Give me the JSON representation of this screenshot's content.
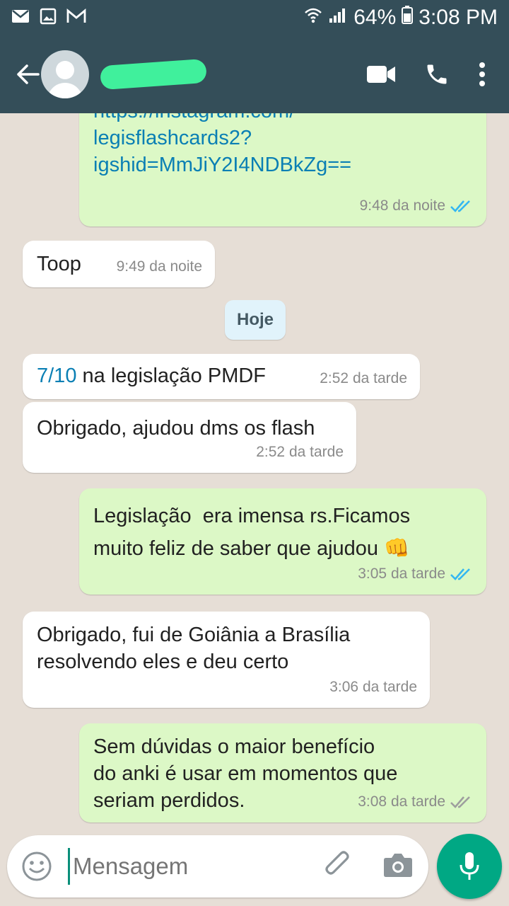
{
  "status_bar": {
    "battery": "64%",
    "time": "3:08 PM"
  },
  "app_bar": {
    "contact_name": ""
  },
  "messages": [
    {
      "dir": "out",
      "lines": [
        "https://instagram.com/",
        "legisflashcards2?",
        "igshid=MmJiY2I4NDBkZg=="
      ],
      "time": "9:48 da noite",
      "ticks": "read"
    },
    {
      "dir": "in",
      "text": "Toop",
      "time": "9:49 da noite"
    },
    {
      "dir": "in",
      "prefix_link": "7/10",
      "text": " na legislação PMDF",
      "time": "2:52 da tarde"
    },
    {
      "dir": "in",
      "text": "Obrigado, ajudou dms os flash",
      "time": "2:52 da tarde"
    },
    {
      "dir": "out",
      "text": "Legislação  era imensa rs.Ficamos\nmuito feliz de saber que ajudou 👊",
      "time": "3:05 da tarde",
      "ticks": "read"
    },
    {
      "dir": "in",
      "text": "Obrigado, fui de Goiânia a Brasília\nresolvendo eles e deu certo",
      "time": "3:06 da tarde"
    },
    {
      "dir": "out",
      "text": "Sem dúvidas o maior benefício\ndo anki é usar em momentos que\nseriam perdidos.",
      "time": "3:08 da tarde",
      "ticks": "delivered"
    }
  ],
  "date_chip": "Hoje",
  "input": {
    "placeholder": "Mensagem"
  },
  "colors": {
    "header": "#344e59",
    "outgoing": "#dcf8c6",
    "incoming": "#ffffff",
    "accent": "#00a884",
    "read_tick": "#34b7f1",
    "link": "#0a7fb4"
  },
  "icons": [
    "mail-icon",
    "image-icon",
    "gmail-icon",
    "wifi-icon",
    "signal-icon",
    "battery-icon",
    "back-arrow-icon",
    "video-call-icon",
    "phone-icon",
    "more-vert-icon",
    "emoji-icon",
    "attach-icon",
    "camera-icon",
    "mic-icon",
    "double-check-icon"
  ]
}
